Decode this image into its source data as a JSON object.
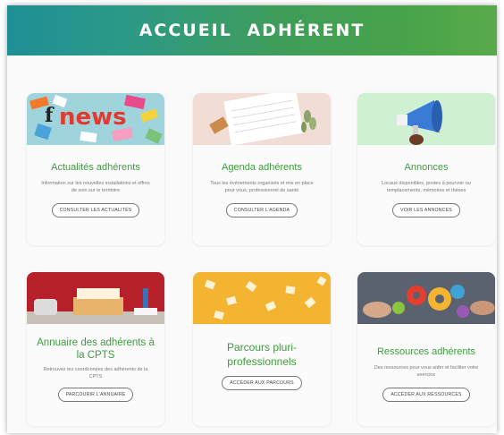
{
  "header": {
    "title": "ACCUEIL ADHÉRENT"
  },
  "cards": [
    {
      "title": "Actualités adhérents",
      "description": "Information sur les nouvelles installations et offres de soin sur le territoire",
      "button": "CONSULTER LES ACTUALITÉS",
      "image_text": "news"
    },
    {
      "title": "Agenda adhérents",
      "description": "Tous les événements organisés et mis en place pour vous, professionnel de santé",
      "button": "CONSULTER L'AGENDA"
    },
    {
      "title": "Annonces",
      "description": "Locaux disponibles, postes à pourvoir ou remplacements, mémoires et thèses",
      "button": "VOIR LES ANNONCES"
    },
    {
      "title": "Annuaire des adhérents à la CPTS",
      "description": "Retrouvez les coordonnées des adhérents de la CPTS",
      "button": "PARCOURIR L'ANNUAIRE"
    },
    {
      "title": "Parcours pluri-professionnels",
      "description": "",
      "button": "ACCÉDER AUX PARCOURS"
    },
    {
      "title": "Ressources adhérents",
      "description": "Des ressources pour vous aider et faciliter votre exercice",
      "button": "ACCÉDER AUX RESSOURCES"
    }
  ]
}
